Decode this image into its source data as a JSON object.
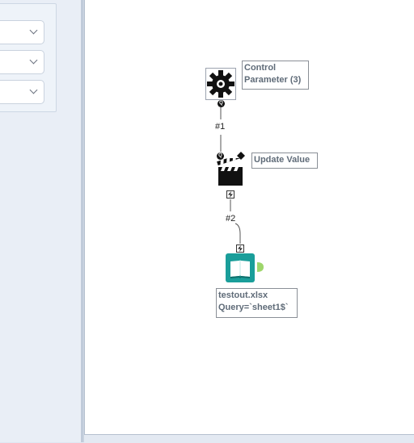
{
  "tools": {
    "control_parameter": {
      "label_line1": "Control",
      "label_line2": "Parameter (3)",
      "icon": "gear-icon"
    },
    "update_value": {
      "label": "Update Value",
      "icon": "clapperboard-icon"
    },
    "input_data": {
      "label_line1": "testout.xlsx",
      "label_line2": "Query=`sheet1$`",
      "icon": "book-icon",
      "accent": "#1a9e9a"
    }
  },
  "connections": {
    "c1": "#1",
    "c2": "#2"
  },
  "colors": {
    "canvas": "#ffffff",
    "panel": "#e9eef6",
    "input_tool": "#1a9e9a",
    "output_anchor": "#9ed66b"
  }
}
